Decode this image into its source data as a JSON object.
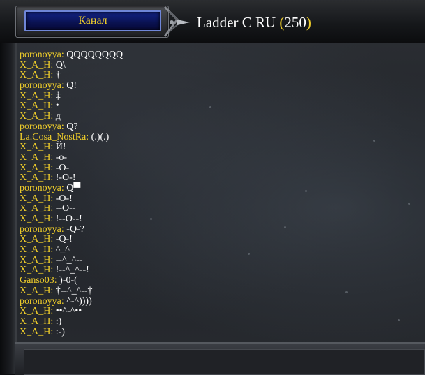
{
  "header": {
    "channel_button": "Канал",
    "channel_name": "Ladder C RU",
    "open_paren": "(",
    "user_count": "250",
    "close_paren": ")"
  },
  "chat": {
    "messages": [
      {
        "user": "poronoyya",
        "text": "QQQQQQQQ"
      },
      {
        "user": "X_A_H",
        "text": "Q\\"
      },
      {
        "user": "X_A_H",
        "text": "†"
      },
      {
        "user": "poronoyya",
        "text": "Q!"
      },
      {
        "user": "X_A_H",
        "text": "‡"
      },
      {
        "user": "X_A_H",
        "text": "•"
      },
      {
        "user": "X_A_H",
        "text": "д"
      },
      {
        "user": "poronoyya",
        "text": "Q?"
      },
      {
        "user": "La.Cosa_NostRa",
        "text": "(.)(.)"
      },
      {
        "user": "X_A_H",
        "text": "Й!"
      },
      {
        "user": "X_A_H",
        "text": "-o-"
      },
      {
        "user": "X_A_H",
        "text": "-O-"
      },
      {
        "user": "X_A_H",
        "text": "!-O-!"
      },
      {
        "user": "poronoyya",
        "text": "Q▀"
      },
      {
        "user": "X_A_H",
        "text": "-O-!"
      },
      {
        "user": "X_A_H",
        "text": "--O--"
      },
      {
        "user": "X_A_H",
        "text": "!--O--!"
      },
      {
        "user": "poronoyya",
        "text": "-Q-?"
      },
      {
        "user": "X_A_H",
        "text": "-Q-!"
      },
      {
        "user": "X_A_H",
        "text": "^_^"
      },
      {
        "user": "X_A_H",
        "text": "--^_^--"
      },
      {
        "user": "X_A_H",
        "text": "!--^_^--!"
      },
      {
        "user": "Ganso03",
        "text": ")-0-("
      },
      {
        "user": "X_A_H",
        "text": "†--^_^--†"
      },
      {
        "user": "poronoyya",
        "text": "^-^))))"
      },
      {
        "user": "X_A_H",
        "text": "••^-^••"
      },
      {
        "user": "X_A_H",
        "text": ":)"
      },
      {
        "user": "X_A_H",
        "text": ":-)"
      }
    ]
  },
  "colors": {
    "username": "#f1cf2a",
    "message": "#ffffff",
    "button_bg": "#13248a"
  }
}
